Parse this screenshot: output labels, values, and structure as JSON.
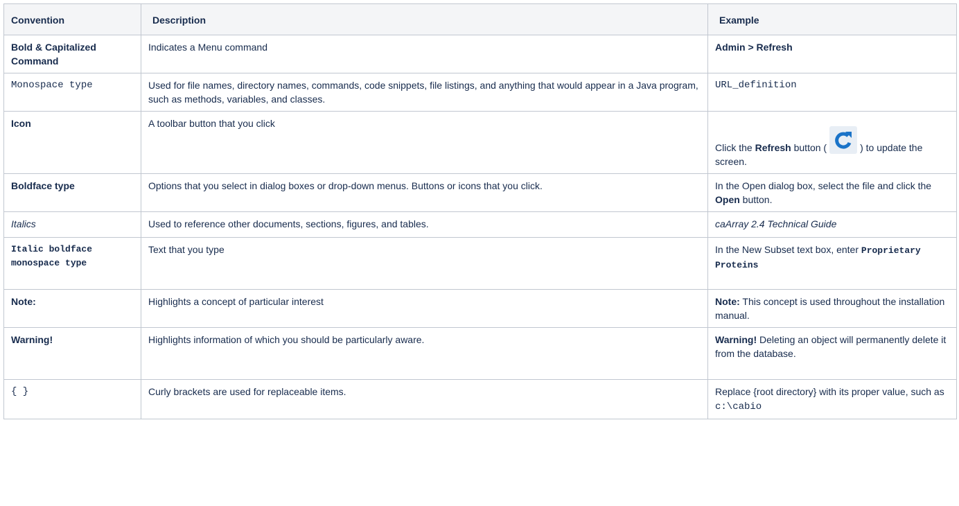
{
  "headers": {
    "convention": "Convention",
    "description": "Description",
    "example": "Example"
  },
  "rows": [
    {
      "convention": "Bold & Capitalized Command",
      "description": "Indicates a Menu command",
      "example": "Admin > Refresh"
    },
    {
      "convention": "Monospace type",
      "description": "Used for file names, directory names, commands, code snippets, file listings, and anything that would appear in a Java program, such as methods, variables, and classes.",
      "example": "URL_definition"
    },
    {
      "convention": "Icon",
      "description": "A toolbar button that you click",
      "example_pre": "Click the ",
      "example_bold": "Refresh",
      "example_mid": " button (",
      "example_post": ") to update the screen.",
      "icon": "refresh-icon",
      "icon_color": "#1a73c8"
    },
    {
      "convention": "Boldface type",
      "description": "Options that you select in dialog boxes or drop-down menus. Buttons or icons that you click.",
      "example_pre": "In the Open dialog box, select the file and click the ",
      "example_bold": "Open",
      "example_post": " button."
    },
    {
      "convention": "Italics",
      "description": "Used to reference other documents, sections, figures, and tables.",
      "example": "caArray 2.4 Technical Guide"
    },
    {
      "convention": "Italic boldface monospace type",
      "description": "Text that you type",
      "example_pre": "In the New Subset text box, enter ",
      "example_code": "Proprietary Proteins"
    },
    {
      "convention": "Note:",
      "description": "Highlights a concept of particular interest",
      "example_bold": "Note:",
      "example_post": " This concept is used throughout the installation manual."
    },
    {
      "convention": "Warning!",
      "description": "Highlights information of which you should be particularly aware.",
      "example_bold": "Warning!",
      "example_post": " Deleting an object will permanently delete it from the database."
    },
    {
      "convention": "{ }",
      "description": "Curly brackets are used for replaceable items.",
      "example_pre": "Replace {root directory} with its proper value, such as ",
      "example_code": "c:\\cabio"
    }
  ]
}
